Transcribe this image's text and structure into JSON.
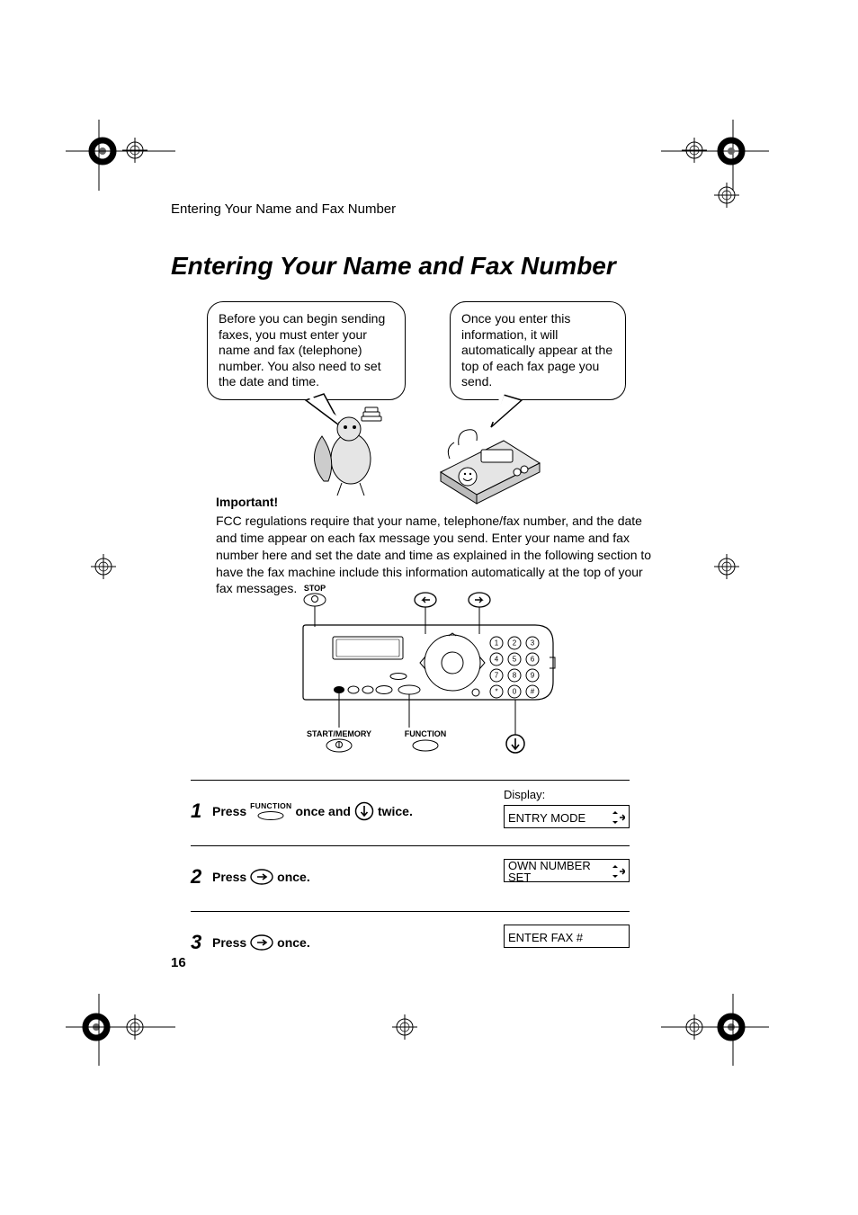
{
  "runningHeader": "Entering Your Name and Fax Number",
  "title": "Entering Your Name and Fax Number",
  "bubbles": {
    "left": "Before you can begin sending faxes, you must enter your name and fax (telephone) number. You also need to set the date and time.",
    "right": "Once you enter this information, it will automatically appear at the top of each fax page you send."
  },
  "important": {
    "label": "Important!",
    "text": "FCC regulations require that your name, telephone/fax number, and the date and time appear on each fax message you send. Enter your name and fax number here and set the date and time as explained in the following section to have the fax machine include this information automatically at the top of your fax messages."
  },
  "diagram": {
    "labels": {
      "stop": "STOP",
      "startMemory": "START/MEMORY",
      "function": "FUNCTION"
    },
    "keypad": [
      "1",
      "2",
      "3",
      "4",
      "5",
      "6",
      "7",
      "8",
      "9",
      "*",
      "0",
      "#"
    ]
  },
  "steps": {
    "s1": {
      "num": "1",
      "parts": {
        "press": "Press",
        "funcLabel": "FUNCTION",
        "onceAnd": "once and",
        "twice": "twice."
      },
      "displayLabel": "Display:",
      "displayText": "ENTRY MODE"
    },
    "s2": {
      "num": "2",
      "parts": {
        "press": "Press",
        "once": "once."
      },
      "displayText": "OWN NUMBER SET"
    },
    "s3": {
      "num": "3",
      "parts": {
        "press": "Press",
        "once": "once."
      },
      "displayText": "ENTER FAX #"
    }
  },
  "pageNumber": "16"
}
